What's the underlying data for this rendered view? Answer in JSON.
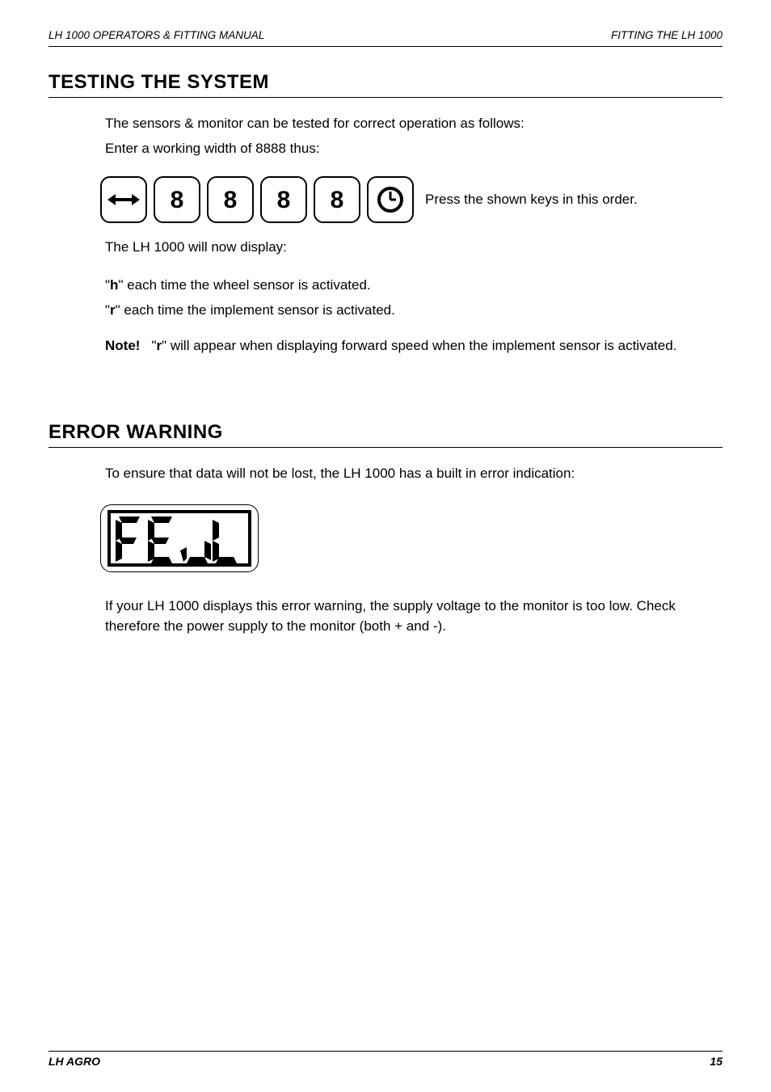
{
  "header": {
    "left": "LH 1000 OPERATORS & FITTING MANUAL",
    "right": "FITTING THE LH 1000"
  },
  "section1": {
    "title": "TESTING THE SYSTEM",
    "p1": "The sensors & monitor can be tested for correct operation as follows:",
    "p2": "Enter a working width of 8888 thus:",
    "keys": {
      "k1": "8",
      "k2": "8",
      "k3": "8",
      "k4": "8"
    },
    "keyNote": "Press the shown keys in this order.",
    "p3": "The LH 1000 will now display:",
    "p4a": "\"",
    "p4b": "h",
    "p4c": "\" each time the wheel sensor is activated.",
    "p5a": "\"",
    "p5b": "r",
    "p5c": "\" each time the implement sensor is activated.",
    "noteLabel": "Note!",
    "noteA": "\"",
    "noteB": "r",
    "noteC": "\" will appear when displaying forward speed when the implement sensor is activated."
  },
  "section2": {
    "title": "ERROR WARNING",
    "p1": "To ensure that data will not be lost, the LH 1000 has a built in error indication:",
    "p2": "If your LH 1000 displays this error warning, the supply voltage to the monitor is too low. Check therefore the power supply to the monitor (both + and -)."
  },
  "footer": {
    "left": "LH AGRO",
    "right": "15"
  }
}
